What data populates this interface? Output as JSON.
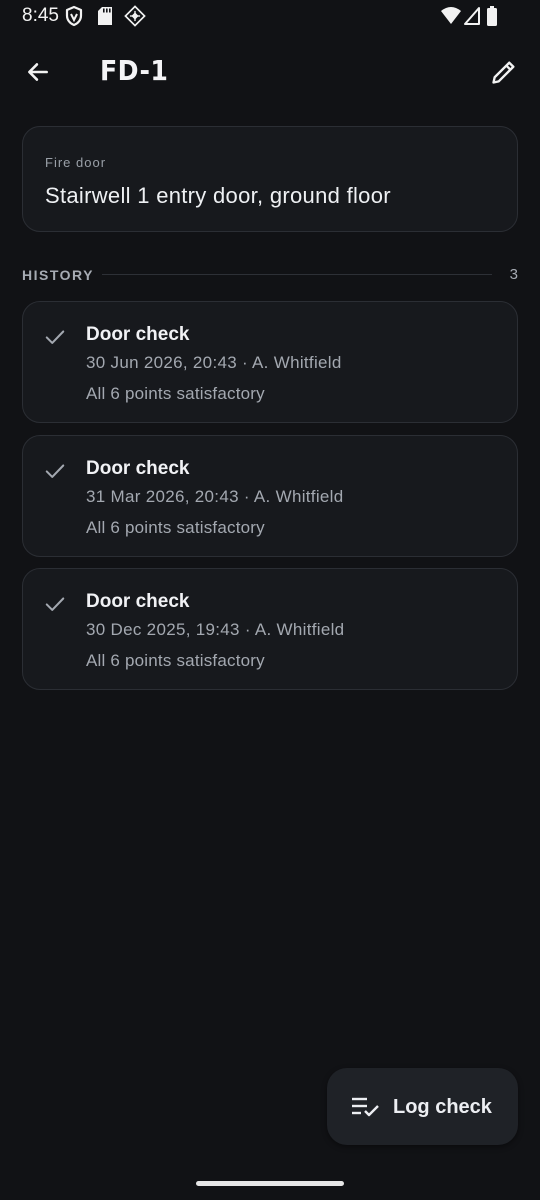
{
  "status_bar": {
    "time": "8:45",
    "icons": [
      "vpn-shield-icon",
      "sd-card-icon",
      "app-grid-icon",
      "wifi-icon",
      "signal-icon",
      "battery-icon"
    ]
  },
  "app_bar": {
    "title": "FD-1",
    "back_icon": "arrow-left-icon",
    "edit_icon": "pencil-icon"
  },
  "asset": {
    "type_label": "Fire door",
    "description": "Stairwell 1 entry door, ground floor"
  },
  "history": {
    "label": "HISTORY",
    "count": "3",
    "items": [
      {
        "title": "Door check",
        "meta": "30 Jun 2026, 20:43 · A. Whitfield",
        "summary": "All 6 points satisfactory"
      },
      {
        "title": "Door check",
        "meta": "31 Mar 2026, 20:43 · A. Whitfield",
        "summary": "All 6 points satisfactory"
      },
      {
        "title": "Door check",
        "meta": "30 Dec 2025, 19:43 · A. Whitfield",
        "summary": "All 6 points satisfactory"
      }
    ]
  },
  "fab": {
    "label": "Log check",
    "icon": "checklist-icon"
  },
  "colors": {
    "background": "#111215",
    "card": "#17191d",
    "card_border": "#2b2e34",
    "fab": "#1f2227",
    "muted_text": "#a3a8b0"
  }
}
